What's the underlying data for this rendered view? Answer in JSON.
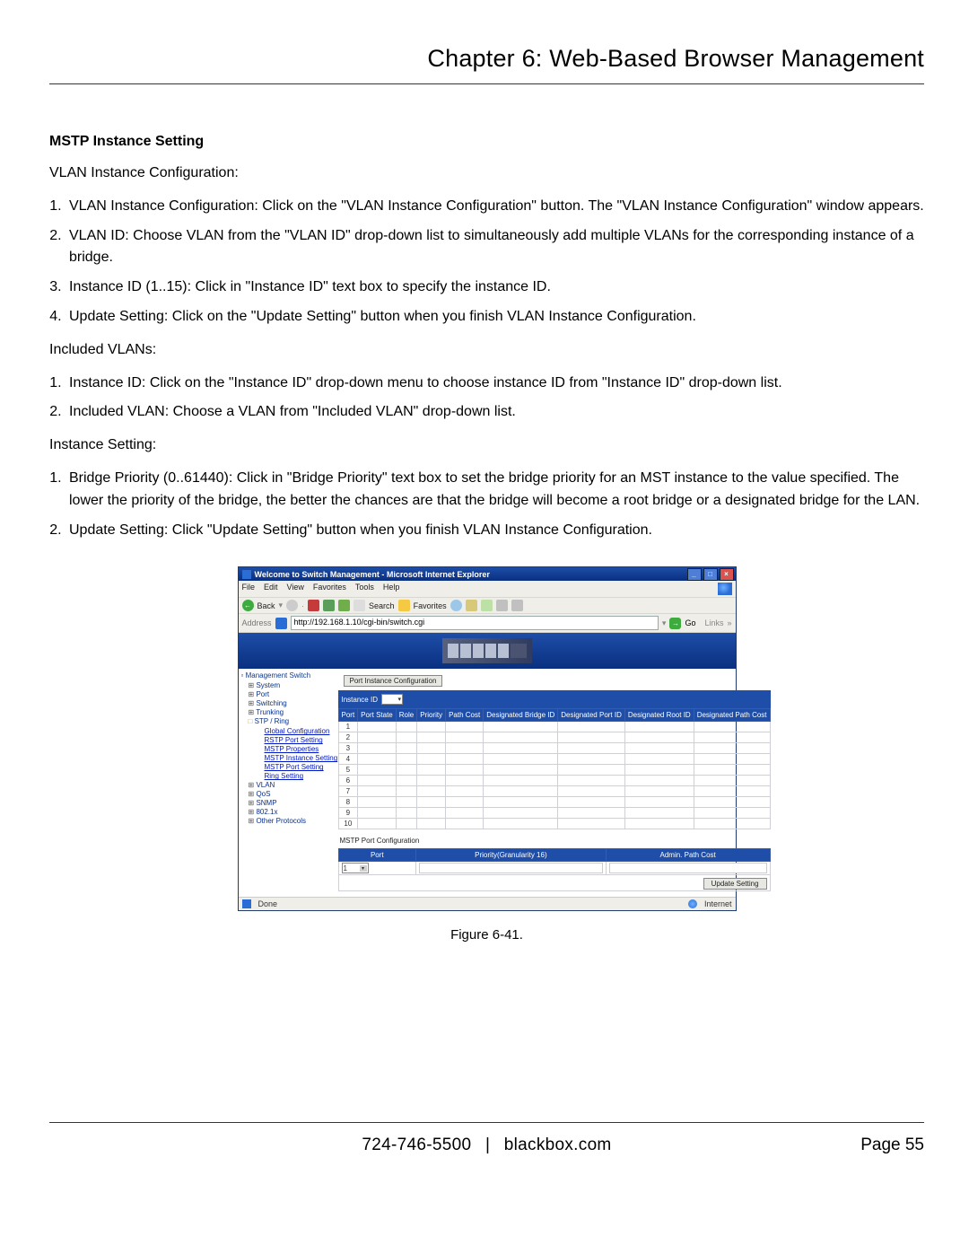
{
  "header": {
    "chapter_title": "Chapter 6: Web-Based Browser Management"
  },
  "section": {
    "heading": "MSTP Instance Setting",
    "vlan_instance_intro": "VLAN Instance Configuration:",
    "vlan_steps": [
      "VLAN Instance Configuration: Click on the \"VLAN Instance Configuration\" button. The \"VLAN Instance Configuration\" window appears.",
      "VLAN ID: Choose VLAN from the \"VLAN ID\" drop-down list to simultaneously add multiple VLANs for the corresponding instance of a bridge.",
      "Instance ID (1..15): Click in \"Instance ID\" text box to specify the instance ID.",
      "Update Setting: Click on the \"Update Setting\" button when you finish VLAN Instance Configuration."
    ],
    "included_intro": "Included VLANs:",
    "included_steps": [
      "Instance ID: Click on the \"Instance ID\" drop-down menu to choose instance ID from \"Instance ID\" drop-down list.",
      "Included VLAN: Choose a VLAN from \"Included VLAN\" drop-down list."
    ],
    "instance_intro": "Instance Setting:",
    "instance_steps": [
      "Bridge Priority (0..61440): Click in \"Bridge Priority\" text box to set the bridge priority for an MST instance to the value specified. The lower the priority of the bridge, the better the chances are that the bridge will become a root bridge or a designated bridge for the LAN.",
      "Update Setting: Click \"Update Setting\" button when you finish VLAN Instance Configuration."
    ]
  },
  "screenshot": {
    "window_title": "Welcome to Switch Management - Microsoft Internet Explorer",
    "menubar": [
      "File",
      "Edit",
      "View",
      "Favorites",
      "Tools",
      "Help"
    ],
    "toolbar": {
      "back": "Back",
      "search": "Search",
      "favorites": "Favorites"
    },
    "address": {
      "label": "Address",
      "value": "http://192.168.1.10/cgi-bin/switch.cgi",
      "go": "Go",
      "links": "Links"
    },
    "tree": {
      "root": "Management Switch",
      "items": [
        "System",
        "Port",
        "Switching",
        "Trunking",
        "STP / Ring",
        "VLAN",
        "QoS",
        "SNMP",
        "802.1x",
        "Other Protocols"
      ],
      "stp_children": [
        "Global Configuration",
        "RSTP Port Setting",
        "MSTP Properties",
        "MSTP Instance Setting",
        "MSTP Port Setting",
        "Ring Setting"
      ]
    },
    "panel": {
      "section_button": "Port Instance Configuration",
      "instance_id_label": "Instance ID",
      "table_headers": [
        "Port",
        "Port State",
        "Role",
        "Priority",
        "Path Cost",
        "Designated Bridge ID",
        "Designated Port ID",
        "Designated Root ID",
        "Designated Path Cost"
      ],
      "rows": [
        "1",
        "2",
        "3",
        "4",
        "5",
        "6",
        "7",
        "8",
        "9",
        "10"
      ],
      "mstp_sub": "MSTP Port Configuration",
      "mstp_headers": [
        "Port",
        "Priority(Granularity 16)",
        "Admin. Path Cost"
      ],
      "mstp_port_value": "1",
      "update_button": "Update Setting"
    },
    "status": {
      "done": "Done",
      "zone": "Internet"
    }
  },
  "figure_caption": "Figure 6-41.",
  "footer": {
    "phone": "724-746-5500",
    "site": "blackbox.com",
    "page": "Page 55"
  }
}
